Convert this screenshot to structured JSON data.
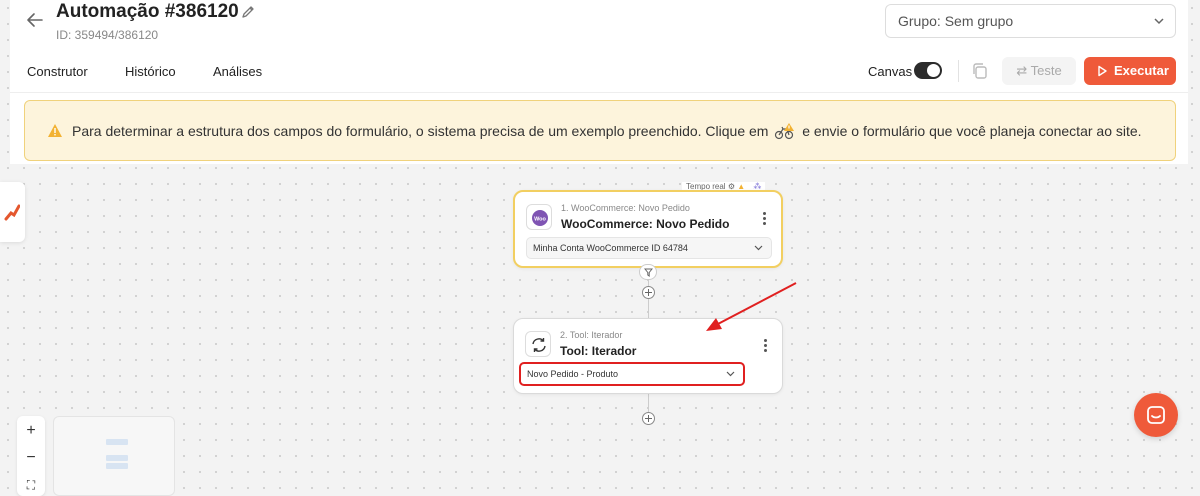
{
  "header": {
    "title": "Automação #386120",
    "subtitle": "ID: 359494/386120",
    "group_select": "Grupo: Sem grupo",
    "icons": [
      "arrow-left-icon",
      "pencil-icon",
      "chevron-down-icon"
    ]
  },
  "tabs": [
    {
      "label": "Construtor"
    },
    {
      "label": "Histórico"
    },
    {
      "label": "Análises"
    }
  ],
  "toolbar": {
    "canvas_label": "Canvas",
    "canvas_toggle_on": true,
    "test_label": "Teste",
    "execute_label": "Executar",
    "execute_color": "#ef5a3a"
  },
  "banner": {
    "text_before": "Para determinar a estrutura dos campos do formulário, o sistema precisa de um exemplo preenchido. Clique em",
    "text_after": "e envie o formulário que você planeja conectar ao site.",
    "background": "#fdf4dc",
    "icons": [
      "warning-icon",
      "bike-warning-icon"
    ]
  },
  "canvas": {
    "realtime_label": "Tempo real",
    "nodes": [
      {
        "sub": "1. WooCommerce: Novo Pedido",
        "title": "WooCommerce: Novo Pedido",
        "select_value": "Minha Conta WooCommerce ID 64784",
        "icon": "woocommerce-icon"
      },
      {
        "sub": "2. Tool: Iterador",
        "title": "Tool: Iterador",
        "select_value": "Novo Pedido - Produto",
        "icon": "refresh-icon"
      }
    ]
  },
  "annotation": {
    "highlight_color": "#e02020"
  }
}
